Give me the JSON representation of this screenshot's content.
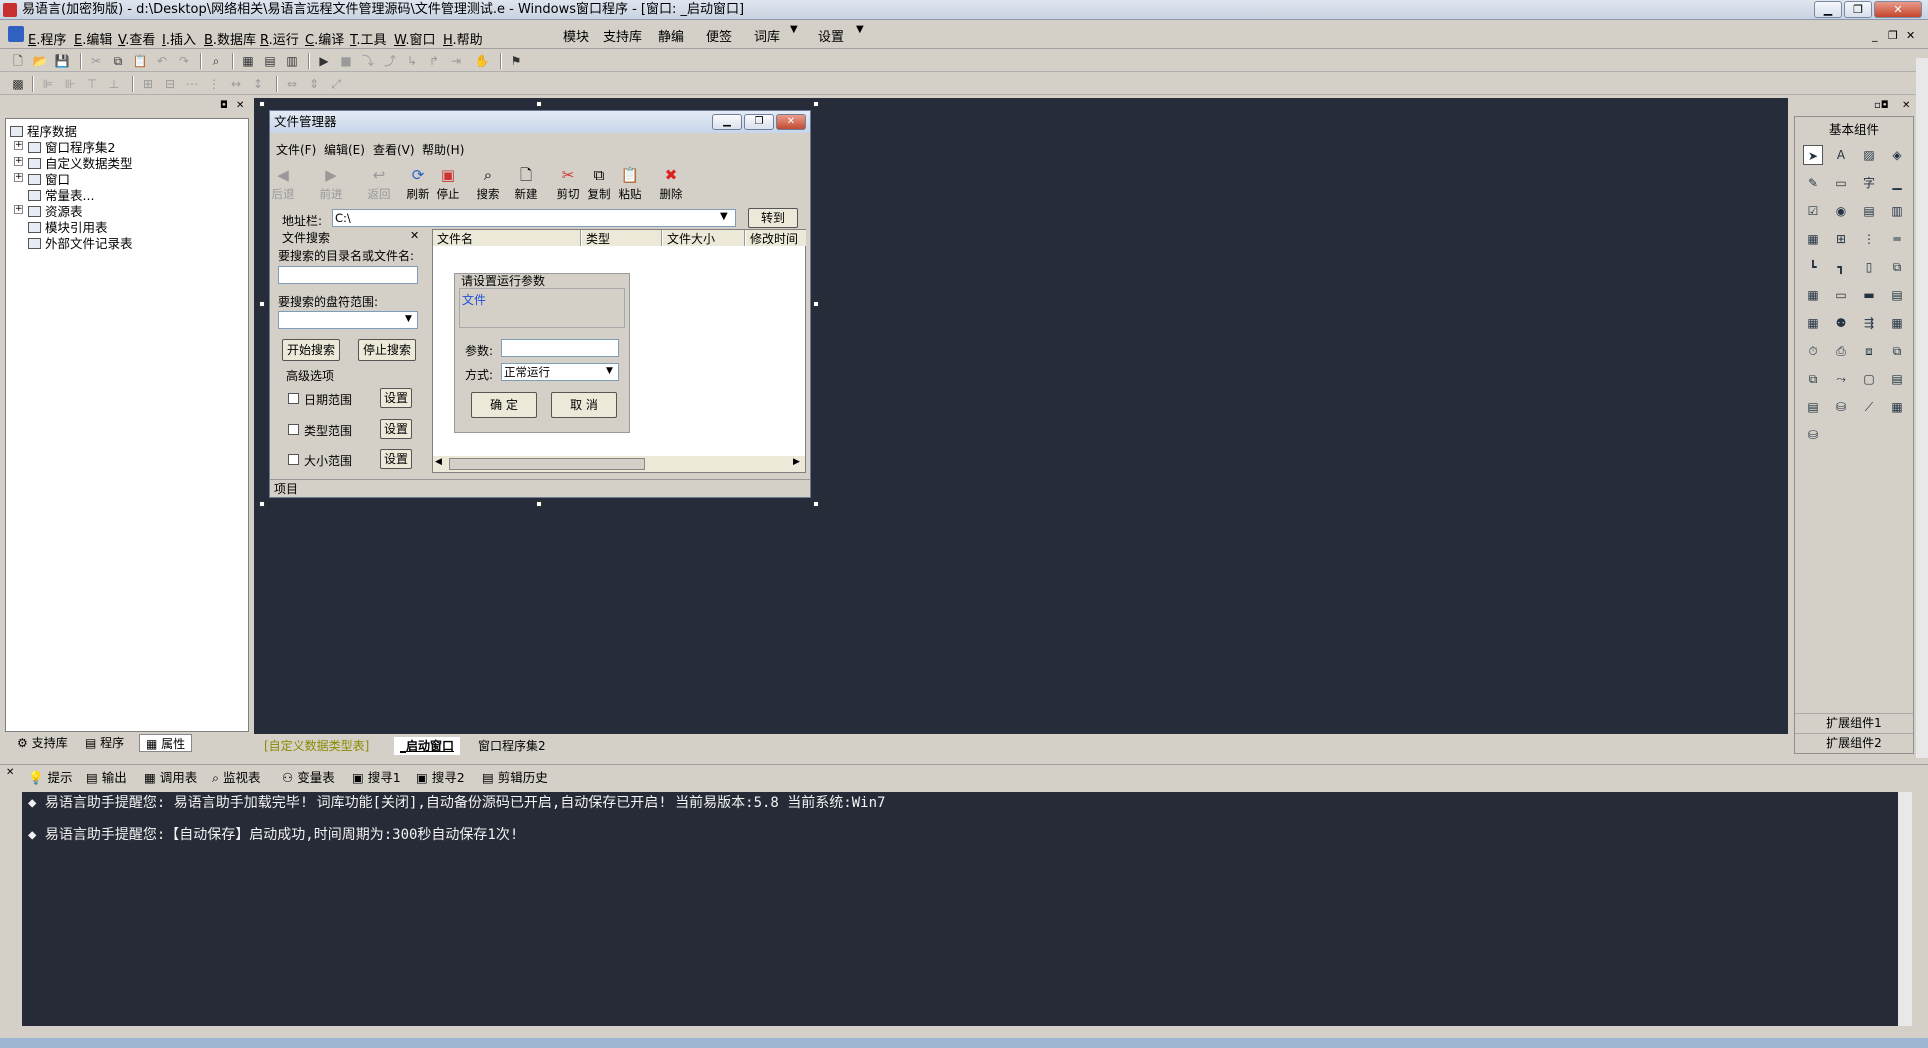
{
  "window": {
    "title": "易语言(加密狗版) - d:\\Desktop\\网络相关\\易语言远程文件管理源码\\文件管理测试.e - Windows窗口程序 - [窗口: _启动窗口]"
  },
  "menu": {
    "items": [
      {
        "key": "E",
        "label": ".程序"
      },
      {
        "key": "E",
        "label": ".编辑"
      },
      {
        "key": "V",
        "label": ".查看"
      },
      {
        "key": "I",
        "label": ".插入"
      },
      {
        "key": "B",
        "label": ".数据库"
      },
      {
        "key": "R",
        "label": ".运行"
      },
      {
        "key": "C",
        "label": ".编译"
      },
      {
        "key": "T",
        "label": ".工具"
      },
      {
        "key": "W",
        "label": ".窗口"
      },
      {
        "key": "H",
        "label": ".帮助"
      }
    ],
    "extra": [
      "模块",
      "支持库",
      "静编",
      "便签",
      "词库",
      "设置"
    ]
  },
  "tree": {
    "root": "程序数据",
    "items": [
      "窗口程序集2",
      "自定义数据类型",
      "窗口",
      "常量表...",
      "资源表",
      "模块引用表",
      "外部文件记录表"
    ]
  },
  "left_tabs": [
    "支持库",
    "程序",
    "属性"
  ],
  "form": {
    "title": "文件管理器",
    "menus": [
      "文件(F)",
      "编辑(E)",
      "查看(V)",
      "帮助(H)"
    ],
    "toolbar": [
      "后退",
      "前进",
      "返回",
      "刷新",
      "停止",
      "搜索",
      "新建",
      "剪切",
      "复制",
      "粘贴",
      "删除"
    ],
    "address_label": "地址栏:",
    "address_value": "C:\\",
    "goto_label": "转到",
    "search_panel_title": "文件搜索",
    "search_dir_label": "要搜索的目录名或文件名:",
    "drive_label": "要搜索的盘符范围:",
    "start_search": "开始搜索",
    "stop_search": "停止搜索",
    "advanced_label": "高级选项",
    "options": [
      {
        "label": "日期范围",
        "btn": "设置"
      },
      {
        "label": "类型范围",
        "btn": "设置"
      },
      {
        "label": "大小范围",
        "btn": "设置"
      }
    ],
    "columns": [
      "文件名",
      "类型",
      "文件大小",
      "修改时间"
    ],
    "dialog": {
      "title": "请设置运行参数",
      "file_label": "文件",
      "param_label": "参数:",
      "mode_label": "方式:",
      "mode_value": "正常运行",
      "ok": "确 定",
      "cancel": "取 消"
    },
    "status": "项目"
  },
  "components": {
    "basic_title": "基本组件",
    "ext1": "扩展组件1",
    "ext2": "扩展组件2"
  },
  "design_tabs": [
    "[自定义数据类型表]",
    "_启动窗口",
    "窗口程序集2"
  ],
  "output_tabs": [
    "提示",
    "输出",
    "调用表",
    "监视表",
    "变量表",
    "搜寻1",
    "搜寻2",
    "剪辑历史"
  ],
  "output_lines": [
    "易语言助手提醒您:  易语言助手加载完毕!  词库功能[关闭],自动备份源码已开启,自动保存已开启!  当前易版本:5.8  当前系统:Win7",
    "易语言助手提醒您:【自动保存】启动成功,时间周期为:300秒自动保存1次!"
  ]
}
